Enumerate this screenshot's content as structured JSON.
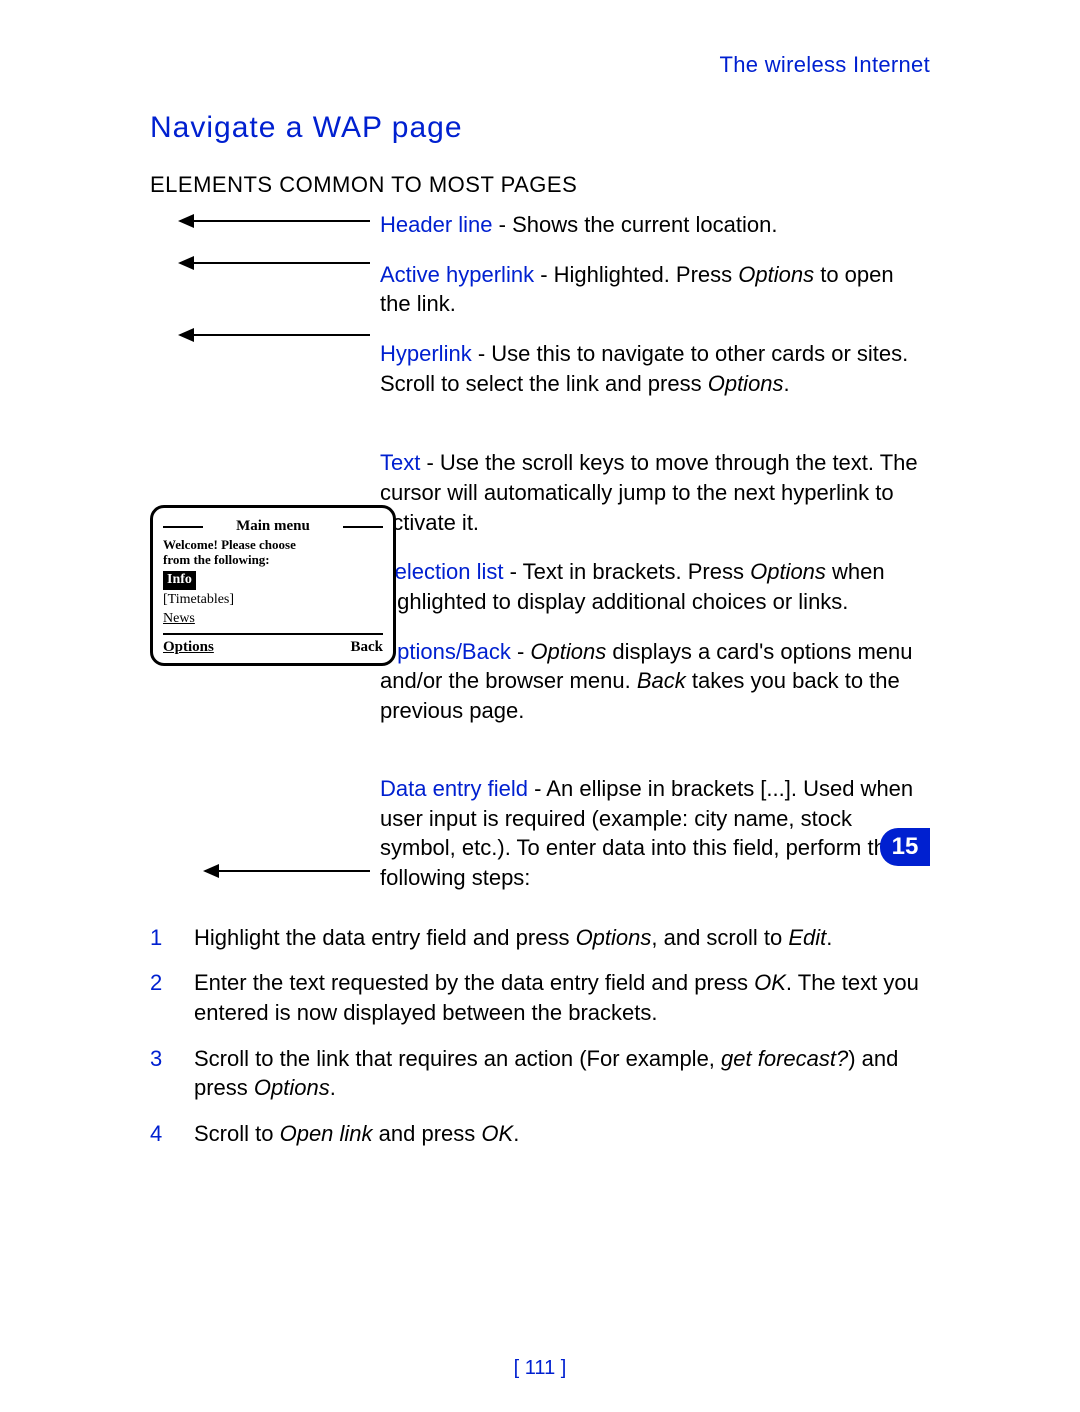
{
  "running_head": "The wireless Internet",
  "section_title": "Navigate a WAP page",
  "subsection": "ELEMENTS COMMON TO MOST PAGES",
  "defs": {
    "header_line": {
      "term": "Header line",
      "body": " - Shows the current location."
    },
    "active_hyperlink": {
      "term": "Active hyperlink",
      "body_a": " - Highlighted. Press ",
      "opt": "Options",
      "body_b": " to open the link."
    },
    "hyperlink": {
      "term": "Hyperlink",
      "body_a": " - Use this to navigate to other cards or sites. Scroll to select the link and press ",
      "opt": "Options",
      "period": "."
    },
    "text": {
      "term": "Text",
      "body_a": " - Use the scroll keys ",
      "to": "to",
      "body_b": " move through the text. The cursor will automatically jump to the next hyperlink to activate it."
    },
    "selection_list": {
      "term": "Selection list",
      "body_a": " - Text in brackets. Press ",
      "opt": "Options",
      "body_b": " when highlighted ",
      "to": "to",
      "body_c": " display additional choices or links."
    },
    "options_back": {
      "term": "Options/Back",
      "dash": " - ",
      "opt": "Options",
      "body_a": " displays a card's options menu and/or the browser menu. ",
      "back": "Back",
      "body_b": " takes you back to the previous page."
    },
    "data_entry": {
      "term": "Data entry field",
      "body": " - An ellipse in brackets [...]. Used when user input is required (example: city name, stock symbol, etc.). To enter data into this field, perform the following steps:"
    }
  },
  "phone": {
    "header": "Main menu",
    "welcome_l1": "Welcome! Please choose",
    "welcome_l2": "from the following:",
    "info": "Info",
    "timetables": "[Timetables]",
    "news": "News",
    "soft_left": "Options",
    "soft_right": "Back"
  },
  "steps": {
    "s1_a": "Highlight the data entry field and press ",
    "s1_opt": "Options",
    "s1_b": ", and scroll to ",
    "s1_edit": "Edit",
    "s1_c": ".",
    "s2_a": "Enter the text requested by the data entry field and press ",
    "s2_ok": "OK",
    "s2_b": ". The text you entered is now displayed between the brackets.",
    "s3_a": "Scroll to the link that requires an action (For example, ",
    "s3_get": "get forecast?",
    "s3_b": ") and press ",
    "s3_opt": "Options",
    "s3_c": ".",
    "s4_a": "Scroll to ",
    "s4_open": "Open link",
    "s4_b": " and press ",
    "s4_ok": "OK",
    "s4_c": "."
  },
  "chapter_number": "15",
  "page_number": "[ 111 ]"
}
